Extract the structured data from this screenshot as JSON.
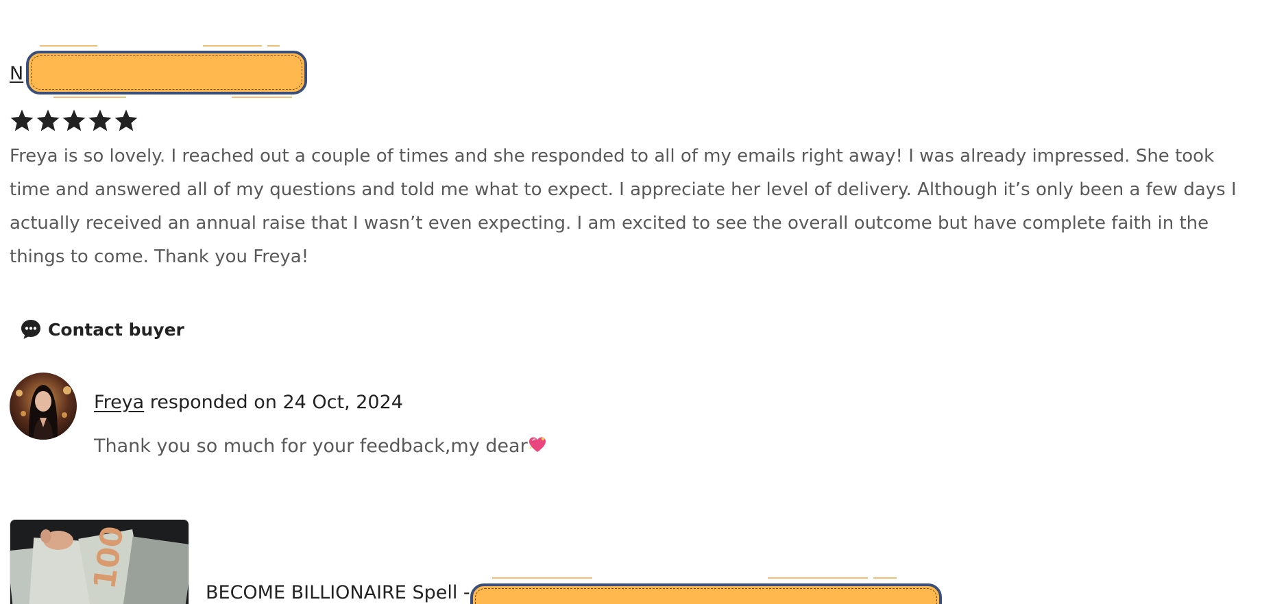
{
  "review": {
    "reviewer_name_visible": "N",
    "rating": 5,
    "rating_max": 5,
    "text_lines": [
      "Freya is so lovely. I reached out a couple of times and she responded to all of my emails right away! I was already impressed. She took",
      "time and answered all of my questions and told me what to expect. I appreciate her level of delivery. Although it’s only been a few days I",
      "actually received an annual raise that I wasn’t even expecting. I am excited to see the overall outcome but have complete faith in the",
      "things to come. Thank you Freya!"
    ],
    "contact_label": "Contact buyer",
    "contact_icon": "chat-bubble-icon"
  },
  "response": {
    "seller_name": "Freya",
    "responded_text": " responded on 24 Oct, 2024",
    "message": "Thank you so much for your feedback,my dear",
    "message_emoji_icon": "sparkling-heart-icon"
  },
  "listing": {
    "title_visible": "BECOME BILLIONAIRE Spell -"
  },
  "colors": {
    "text_primary": "#222222",
    "text_secondary": "#595959",
    "redaction_fill": "#ffb84d",
    "redaction_border": "#3a4f7a"
  }
}
